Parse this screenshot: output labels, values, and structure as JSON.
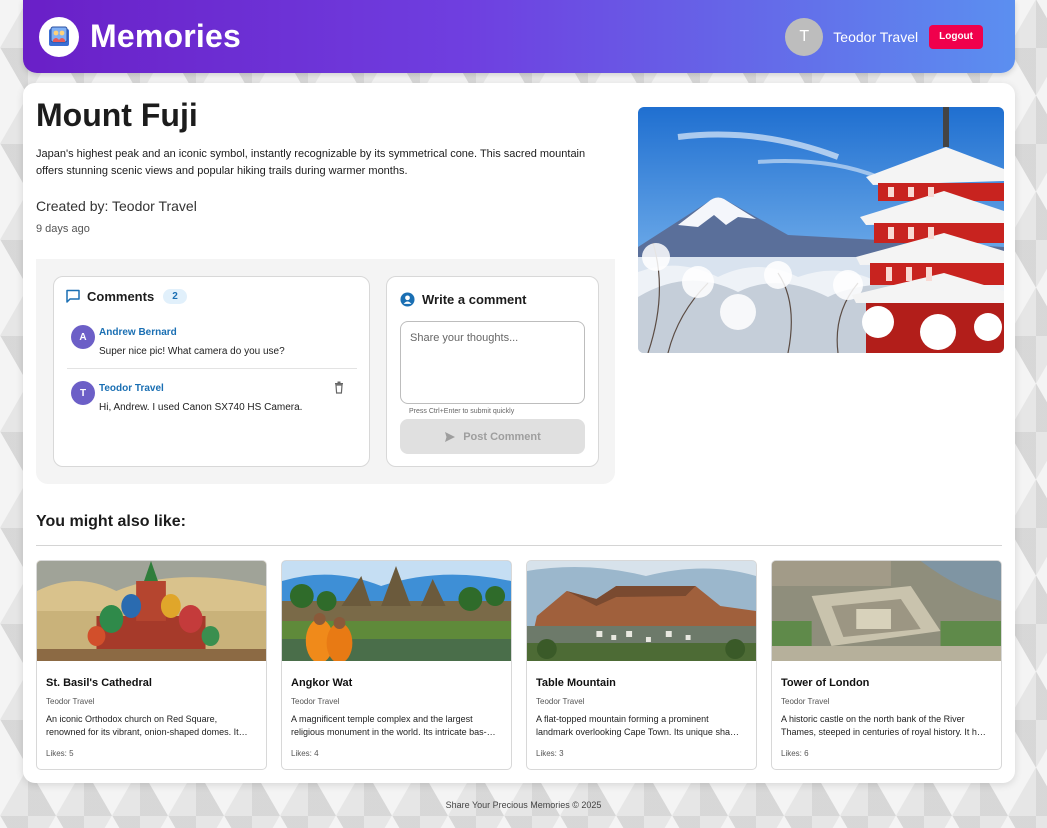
{
  "header": {
    "brand": "Memories",
    "user_initial": "T",
    "user_name": "Teodor Travel",
    "logout_label": "Logout"
  },
  "memory": {
    "title": "Mount Fuji",
    "description": "Japan's highest peak and an iconic symbol, instantly recognizable by its symmetrical cone. This sacred mountain offers stunning scenic views and popular hiking trails during warmer months.",
    "created_by": "Created by: Teodor Travel",
    "time_ago": "9 days ago"
  },
  "comments": {
    "title": "Comments",
    "count": "2",
    "items": [
      {
        "initial": "A",
        "author": "Andrew Bernard",
        "text": "Super nice pic! What camera do you use?"
      },
      {
        "initial": "T",
        "author": "Teodor Travel",
        "text": "Hi, Andrew. I used Canon SX740 HS Camera."
      }
    ]
  },
  "write_comment": {
    "title": "Write a comment",
    "placeholder": "Share your thoughts...",
    "hint": "Press Ctrl+Enter to submit quickly",
    "post_label": "Post Comment"
  },
  "related": {
    "heading": "You might also like:",
    "cards": [
      {
        "title": "St. Basil's Cathedral",
        "author": "Teodor Travel",
        "description": "An iconic Orthodox church on Red Square, renowned for its vibrant, onion-shaped domes. It…",
        "likes": "Likes: 5"
      },
      {
        "title": "Angkor Wat",
        "author": "Teodor Travel",
        "description": "A magnificent temple complex and the largest religious monument in the world. Its intricate bas-…",
        "likes": "Likes: 4"
      },
      {
        "title": "Table Mountain",
        "author": "Teodor Travel",
        "description": "A flat-topped mountain forming a prominent landmark overlooking Cape Town. Its unique sha…",
        "likes": "Likes: 3"
      },
      {
        "title": "Tower of London",
        "author": "Teodor Travel",
        "description": "A historic castle on the north bank of the River Thames, steeped in centuries of royal history. It h…",
        "likes": "Likes: 6"
      }
    ]
  },
  "footer": {
    "text": "Share Your Precious Memories © 2025"
  },
  "colors": {
    "header_gradient_start": "#6a1fc7",
    "header_gradient_end": "#5b8ff0",
    "logout": "#f0004c",
    "link_blue": "#1a6fb3",
    "avatar_purple": "#6c5fc7"
  }
}
